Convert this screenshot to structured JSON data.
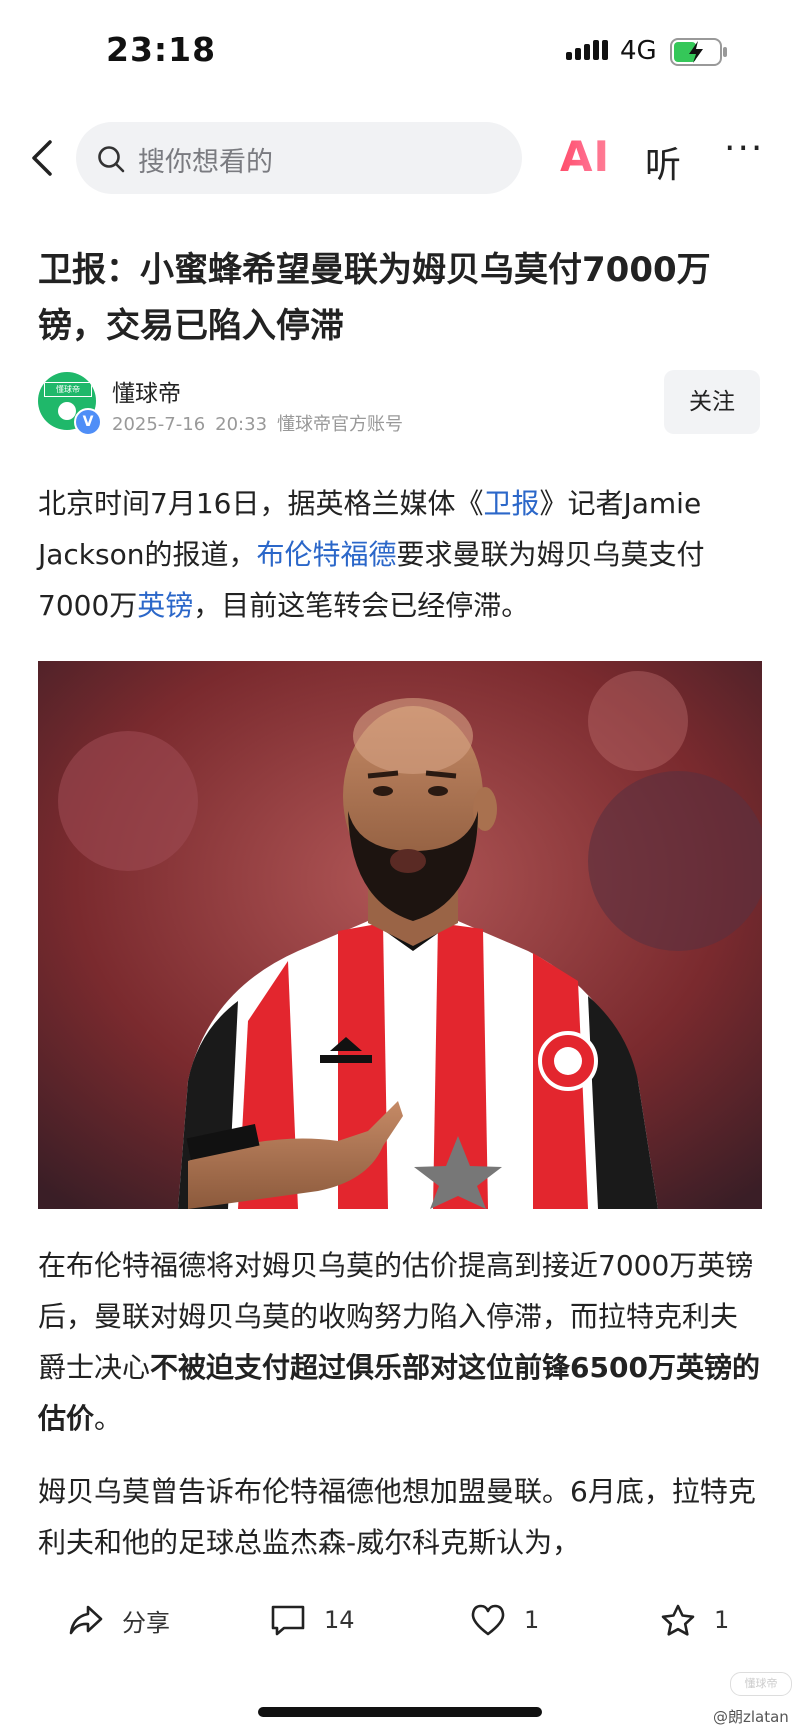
{
  "status_bar": {
    "time": "23:18",
    "network": "4G",
    "battery_icon": "charging-battery-icon",
    "signal_icon": "signal-icon"
  },
  "nav": {
    "search_placeholder": "搜你想看的",
    "ai_label": "AI",
    "listen_label": "听",
    "more_label": "···"
  },
  "article": {
    "title": "卫报：小蜜蜂希望曼联为姆贝乌莫付7000万镑，交易已陷入停滞",
    "author": {
      "name": "懂球帝",
      "date": "2025-7-16",
      "time": "20:33",
      "account_type": "懂球帝官方账号",
      "avatar_text": "懂球帝",
      "verified_mark": "V"
    },
    "follow_label": "关注",
    "p1": {
      "t1": "北京时间7月16日，据英格兰媒体《",
      "link1": "卫报",
      "t2": "》记者Jamie Jackson的报道，",
      "link2": "布伦特福德",
      "t3": "要求曼联为姆贝乌莫支付7000万",
      "link3": "英镑",
      "t4": "，目前这笔转会已经停滞。"
    },
    "p2": {
      "t1": "在布伦特福德将对姆贝乌莫的估价提高到接近7000万英镑后，曼联对姆贝乌莫的收购努力陷入停滞，而拉特克利夫爵士决心",
      "bold": "不被迫支付超过俱乐部对这位前锋6500万英镑的估价",
      "t2": "。"
    },
    "p3": "姆贝乌莫曾告诉布伦特福德他想加盟曼联。6月底，拉特克利夫和他的足球总监杰森-威尔科克斯认为，"
  },
  "bottom_bar": {
    "share_label": "分享",
    "comments_count": "14",
    "likes_count": "1",
    "favorites_count": "1"
  },
  "watermark": {
    "text": "@朗zlatan",
    "badge": "懂球帝"
  },
  "colors": {
    "link": "#2b67c9",
    "accent_ai": "#ff4d6a",
    "brand_green": "#1fb86a"
  }
}
